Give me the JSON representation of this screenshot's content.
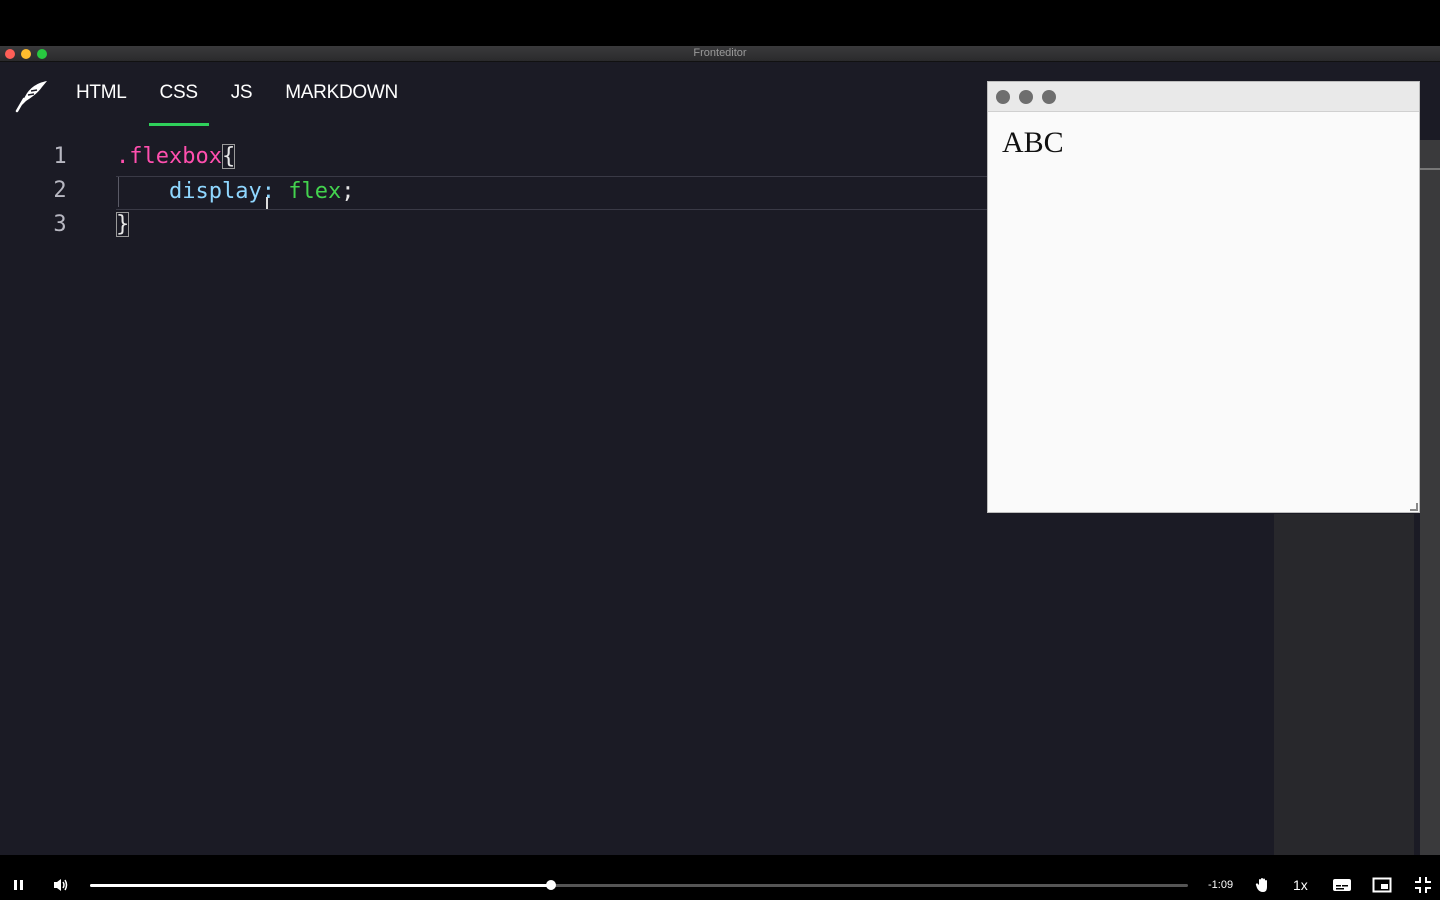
{
  "window": {
    "title": "Fronteditor"
  },
  "editor": {
    "tabs": [
      {
        "label": "HTML",
        "active": false
      },
      {
        "label": "CSS",
        "active": true
      },
      {
        "label": "JS",
        "active": false
      },
      {
        "label": "MARKDOWN",
        "active": false
      }
    ],
    "line_numbers": [
      "1",
      "2",
      "3"
    ],
    "code": {
      "line1_selector": ".flexbox",
      "line1_brace": "{",
      "line2_indent": "    ",
      "line2_property": "display",
      "line2_colon": ":",
      "line2_value": "flex",
      "line2_semicolon": ";",
      "line3_brace": "}"
    },
    "colors": {
      "selector": "#ff4fae",
      "property": "#8fd7ff",
      "value": "#43d34e",
      "active_tab_underline": "#2fd15b"
    }
  },
  "preview": {
    "content": "ABC"
  },
  "player": {
    "time_remaining": "-1:09",
    "speed": "1x",
    "progress": 0.42
  },
  "icons": {
    "logo": "quill-icon",
    "play_pause": "pause-icon",
    "volume": "volume-icon",
    "hand": "hand-icon",
    "captions": "captions-icon",
    "pip": "picture-in-picture-icon",
    "fullscreen": "exit-fullscreen-icon"
  }
}
